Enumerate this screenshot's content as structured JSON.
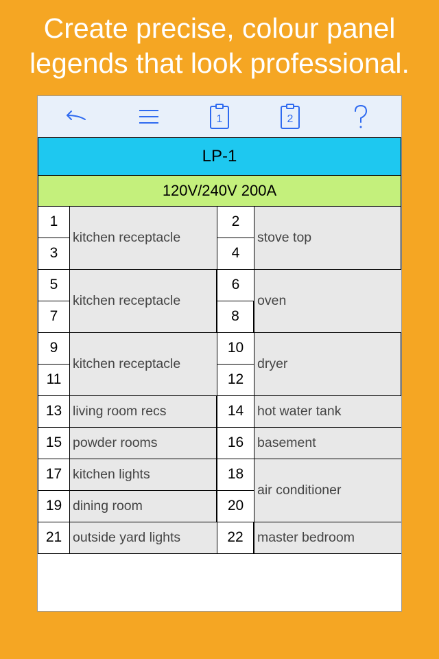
{
  "hero": "Create precise, colour panel  legends that look professional.",
  "panel": {
    "title": "LP-1",
    "spec": "120V/240V 200A"
  },
  "toolbar": {
    "badge1": "1",
    "badge2": "2"
  },
  "circuits": [
    {
      "leftNums": [
        "1",
        "3"
      ],
      "leftLabel": "kitchen receptacle",
      "rightNums": [
        "2",
        "4"
      ],
      "rightLabel": "stove top"
    },
    {
      "leftNums": [
        "5",
        "7"
      ],
      "leftLabel": "kitchen receptacle",
      "rightNums": [
        "6",
        "8"
      ],
      "rightLabel": "oven"
    },
    {
      "leftNums": [
        "9",
        "11"
      ],
      "leftLabel": "kitchen receptacle",
      "rightNums": [
        "10",
        "12"
      ],
      "rightLabel": "dryer"
    },
    {
      "leftNums": [
        "13"
      ],
      "leftLabel": "living room recs",
      "rightNums": [
        "14"
      ],
      "rightLabel": "hot water tank"
    },
    {
      "leftNums": [
        "15"
      ],
      "leftLabel": "powder rooms",
      "rightNums": [
        "16"
      ],
      "rightLabel": "basement"
    },
    {
      "leftNums": [
        "17"
      ],
      "leftLabel": "kitchen lights",
      "rightNums": [
        "18",
        "20"
      ],
      "rightLabel": "air conditioner"
    },
    {
      "leftNums": [
        "19"
      ],
      "leftLabel": "dining room",
      "rightNums": [],
      "rightLabel": null
    },
    {
      "leftNums": [
        "21"
      ],
      "leftLabel": "outside yard lights",
      "rightNums": [
        "22"
      ],
      "rightLabel": "master bedroom"
    }
  ]
}
